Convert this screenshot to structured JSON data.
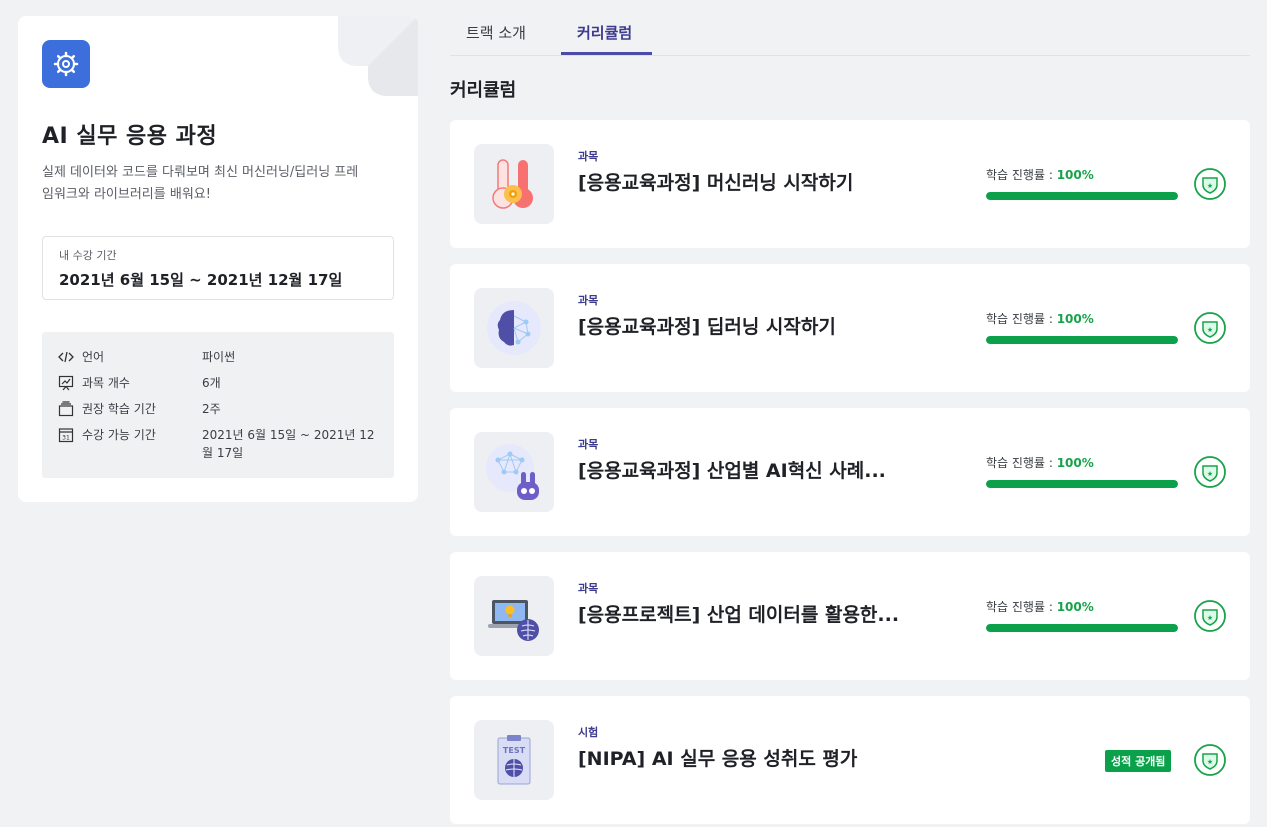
{
  "track": {
    "title": "AI 실무 응용 과정",
    "description": "실제 데이터와 코드를 다뤄보며 최신 머신러닝/딥러닝 프레임워크와 라이브러리를 배워요!",
    "period_label": "내 수강 기간",
    "period_value": "2021년 6월 15일 ~ 2021년 12월 17일",
    "info": [
      {
        "icon": "code-icon",
        "key": "언어",
        "value": "파이썬"
      },
      {
        "icon": "presentation-icon",
        "key": "과목 개수",
        "value": "6개"
      },
      {
        "icon": "layers-icon",
        "key": "권장 학습 기간",
        "value": "2주"
      },
      {
        "icon": "calendar-icon",
        "key": "수강 가능 기간",
        "value": "2021년 6월 15일 ~ 2021년 12월 17일"
      }
    ]
  },
  "tabs": [
    {
      "label": "트랙 소개",
      "active": false
    },
    {
      "label": "커리큘럼",
      "active": true
    }
  ],
  "section_title": "커리큘럼",
  "courses": [
    {
      "type": "과목",
      "name": "[응용교육과정] 머신러닝 시작하기",
      "progress_label": "학습 진행률 : ",
      "progress": "100%",
      "progress_value": 100,
      "thumb": "thermometer-brain-icon"
    },
    {
      "type": "과목",
      "name": "[응용교육과정] 딥러닝 시작하기",
      "progress_label": "학습 진행률 : ",
      "progress": "100%",
      "progress_value": 100,
      "thumb": "neural-brain-icon"
    },
    {
      "type": "과목",
      "name": "[응용교육과정] 산업별 AI혁신 사례...",
      "progress_label": "학습 진행률 : ",
      "progress": "100%",
      "progress_value": 100,
      "thumb": "rabbit-network-icon"
    },
    {
      "type": "과목",
      "name": "[응용프로젝트] 산업 데이터를 활용한...",
      "progress_label": "학습 진행률 : ",
      "progress": "100%",
      "progress_value": 100,
      "thumb": "laptop-brain-icon"
    },
    {
      "type": "시험",
      "name": "[NIPA] AI 실무 응용 성취도 평가",
      "grade_badge": "성적 공개됨",
      "thumb_text": "TEST",
      "thumb": "test-clipboard-icon"
    }
  ],
  "colors": {
    "accent": "#3d3b8e",
    "progress": "#0aa14a",
    "track_icon_bg": "#3d6fdc"
  }
}
